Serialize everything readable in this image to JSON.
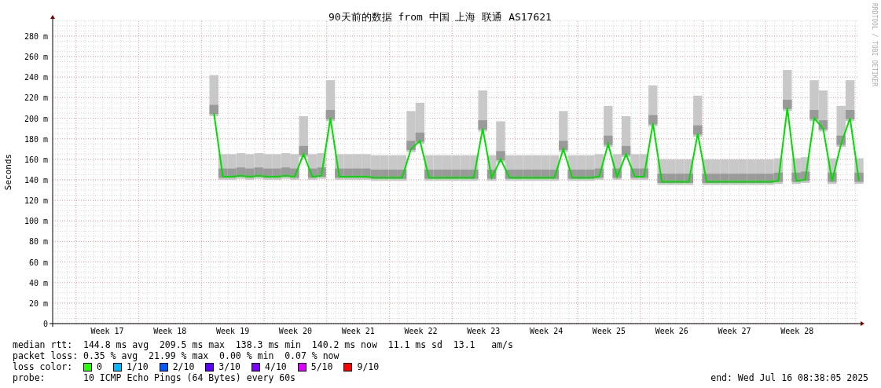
{
  "credit": "RRDTOOL / TOBI OETIKER",
  "chart": {
    "chart_data": {
      "type": "line",
      "title": "90天前的数据 from 中国 上海 联通 AS17621",
      "ylabel": "Seconds",
      "grid": true,
      "ylim": [
        0,
        296
      ],
      "categories": [
        null,
        null,
        null,
        null,
        null,
        null,
        "Week 17",
        null,
        null,
        null,
        null,
        null,
        null,
        "Week 18",
        null,
        null,
        null,
        null,
        null,
        null,
        "Week 19",
        null,
        null,
        null,
        null,
        null,
        null,
        "Week 20",
        null,
        null,
        null,
        null,
        null,
        null,
        "Week 21",
        null,
        null,
        null,
        null,
        null,
        null,
        "Week 22",
        null,
        null,
        null,
        null,
        null,
        null,
        "Week 23",
        null,
        null,
        null,
        null,
        null,
        null,
        "Week 24",
        null,
        null,
        null,
        null,
        null,
        null,
        "Week 25",
        null,
        null,
        null,
        null,
        null,
        null,
        "Week 26",
        null,
        null,
        null,
        null,
        null,
        null,
        "Week 27",
        null,
        null,
        null,
        null,
        null,
        null,
        "Week 28",
        null,
        null,
        null,
        null,
        null,
        null,
        null
      ],
      "yticks": [
        {
          "value": 0,
          "label": "0"
        },
        {
          "value": 20,
          "label": "20 m"
        },
        {
          "value": 40,
          "label": "40 m"
        },
        {
          "value": 60,
          "label": "60 m"
        },
        {
          "value": 80,
          "label": "80 m"
        },
        {
          "value": 100,
          "label": "100 m"
        },
        {
          "value": 120,
          "label": "120 m"
        },
        {
          "value": 140,
          "label": "140 m"
        },
        {
          "value": 160,
          "label": "160 m"
        },
        {
          "value": 180,
          "label": "180 m"
        },
        {
          "value": 200,
          "label": "200 m"
        },
        {
          "value": 220,
          "label": "220 m"
        },
        {
          "value": 240,
          "label": "240 m"
        },
        {
          "value": 260,
          "label": "260 m"
        },
        {
          "value": 280,
          "label": "280 m"
        }
      ],
      "series": [
        {
          "color": "#00dd00",
          "values": [
            null,
            null,
            null,
            null,
            null,
            null,
            null,
            null,
            null,
            null,
            null,
            null,
            null,
            null,
            null,
            null,
            null,
            null,
            205,
            143,
            143,
            144,
            143,
            144,
            143,
            143,
            144,
            143,
            165,
            143,
            144,
            200,
            143,
            143,
            143,
            143,
            142,
            142,
            142,
            142,
            170,
            178,
            142,
            142,
            142,
            142,
            142,
            142,
            190,
            142,
            160,
            142,
            142,
            142,
            142,
            142,
            142,
            170,
            142,
            142,
            142,
            143,
            175,
            143,
            165,
            143,
            143,
            195,
            138,
            138,
            138,
            138,
            185,
            138,
            138,
            138,
            138,
            138,
            138,
            138,
            138,
            139,
            210,
            139,
            140,
            200,
            190,
            139,
            175,
            200,
            139
          ]
        }
      ]
    }
  },
  "legend": {
    "median_rtt": {
      "label": "median rtt:",
      "value": "144.8 ms avg  209.5 ms max  138.3 ms min  140.2 ms now  11.1 ms sd  13.1   am/s"
    },
    "packet_loss": {
      "label": "packet loss:",
      "value": "0.35 % avg  21.99 % max  0.00 % min  0.07 % now"
    },
    "loss_color": {
      "label": "loss color:",
      "items": [
        {
          "label": "0",
          "color": "#26ff00"
        },
        {
          "label": "1/10",
          "color": "#00b8ff"
        },
        {
          "label": "2/10",
          "color": "#0059ff"
        },
        {
          "label": "3/10",
          "color": "#5e00ff"
        },
        {
          "label": "4/10",
          "color": "#7e00ff"
        },
        {
          "label": "5/10",
          "color": "#dd00ff"
        },
        {
          "label": "9/10",
          "color": "#ff0000"
        }
      ]
    },
    "probe": {
      "label": "probe:",
      "value": "10 ICMP Echo Pings (64 Bytes) every 60s"
    },
    "end": "end: Wed Jul 16 08:38:05 2025"
  }
}
